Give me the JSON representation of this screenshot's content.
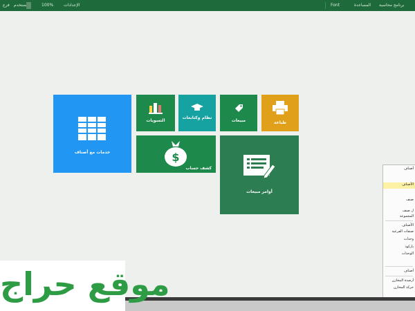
{
  "topbar": {
    "title_right": "برنامج محاسبة",
    "item_2": "المساعدة",
    "item_3": "الإعدادات",
    "item_4": "Font",
    "zoom": "100%",
    "user_label": "المستخدم",
    "branch_label": "فرع"
  },
  "tiles": {
    "items_statement": "كشف حساب",
    "items_report": "خدمات مع أصناف",
    "settlements": "التسويات",
    "systems": "نظام وكتابعات",
    "sales": "مبيعات",
    "print": "طباعة",
    "account_statement": "كشف حساب",
    "sales_orders": "أوامر مبيعات"
  },
  "menu": {
    "items": [
      "أصناف",
      "",
      "الأصناف",
      "",
      "صنف",
      "",
      "ل صنف",
      "المجموعة",
      "الأصناف",
      "صنفات الفرعية",
      "وحدات",
      "باركود",
      "الوحدات",
      "",
      "أصناف",
      "أرصدة المخازن",
      "حركة المخازن"
    ]
  },
  "watermark": {
    "text": "موقع حراج"
  },
  "colors": {
    "topbar": "#1f6a3a",
    "blue_tile": "#2196f3",
    "green_tile": "#1d8a4c",
    "teal_tile": "#17a2a2",
    "amber_tile": "#e0a019",
    "dark_green_tile": "#2d7d52",
    "watermark_green": "#2e9b45"
  }
}
